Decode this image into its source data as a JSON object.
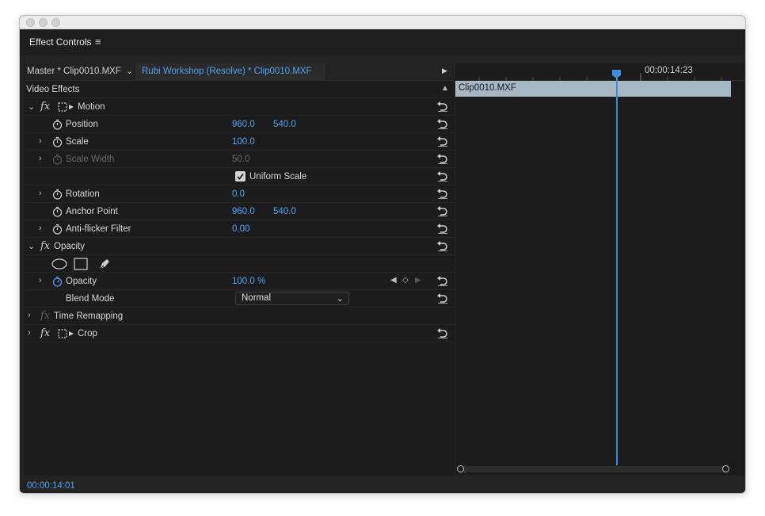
{
  "panel": {
    "title": "Effect Controls",
    "menu_icon": "hamburger-icon"
  },
  "tabs": {
    "master": "Master * Clip0010.MXF",
    "active": "Rubi Workshop (Resolve) * Clip0010.MXF"
  },
  "section": {
    "video_effects": "Video Effects"
  },
  "motion": {
    "name": "Motion",
    "position": {
      "label": "Position",
      "x": "960.0",
      "y": "540.0"
    },
    "scale": {
      "label": "Scale",
      "value": "100.0"
    },
    "scale_width": {
      "label": "Scale Width",
      "value": "50.0"
    },
    "uniform_scale": {
      "label": "Uniform Scale",
      "checked": true
    },
    "rotation": {
      "label": "Rotation",
      "value": "0.0"
    },
    "anchor_point": {
      "label": "Anchor Point",
      "x": "960.0",
      "y": "540.0"
    },
    "anti_flicker": {
      "label": "Anti-flicker Filter",
      "value": "0.00"
    }
  },
  "opacity": {
    "name": "Opacity",
    "opacity_param": {
      "label": "Opacity",
      "value": "100.0 %"
    },
    "blend_mode": {
      "label": "Blend Mode",
      "value": "Normal"
    }
  },
  "time_remapping": {
    "name": "Time Remapping"
  },
  "crop": {
    "name": "Crop"
  },
  "fx_label": "fx",
  "timeline": {
    "timecode_ruler": "00:00:14:23",
    "clip_name": "Clip0010.MXF",
    "current_timecode": "00:00:14:01"
  },
  "colors": {
    "accent": "#4ea3f1",
    "clip_bar": "#a7b6c3",
    "playhead": "#3e8ddc"
  }
}
